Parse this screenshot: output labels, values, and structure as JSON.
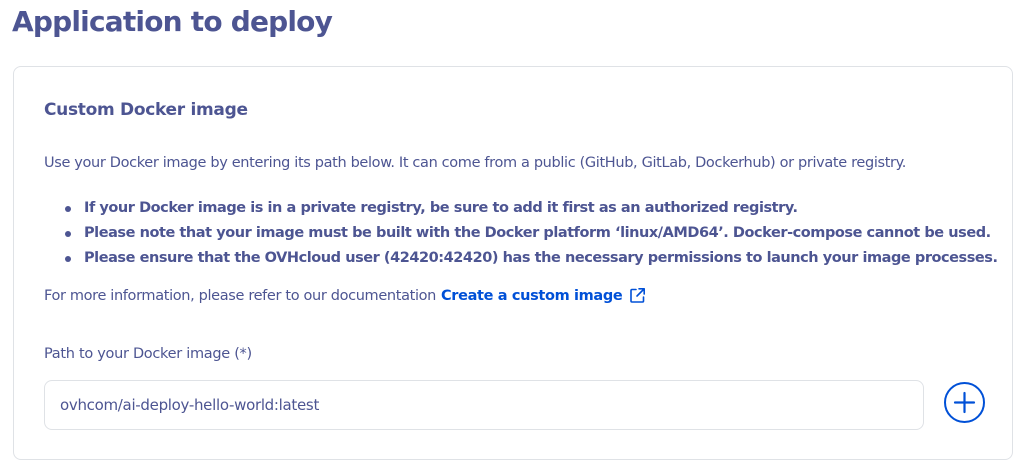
{
  "page": {
    "title": "Application to deploy"
  },
  "card": {
    "title": "Custom Docker image",
    "intro": "Use your Docker image by entering its path below. It can come from a public (GitHub, GitLab, Dockerhub) or private registry.",
    "notes": [
      "If your Docker image is in a private registry, be sure to add it first as an authorized registry.",
      "Please note that your image must be built with the Docker platform ‘linux/AMD64’. Docker-compose cannot be used.",
      "Please ensure that the OVHcloud user (42420:42420) has the necessary permissions to launch your image processes."
    ],
    "more_info": {
      "text": "For more information, please refer to our documentation",
      "link_label": "Create a custom image",
      "link_icon": "external-link-icon"
    },
    "field": {
      "label": "Path to your Docker image (*)",
      "value": "ovhcom/ai-deploy-hello-world:latest",
      "add_icon": "plus-circle-icon"
    }
  },
  "colors": {
    "text": "#4d5592",
    "link": "#0050d7",
    "border": "#dfe2e6"
  }
}
